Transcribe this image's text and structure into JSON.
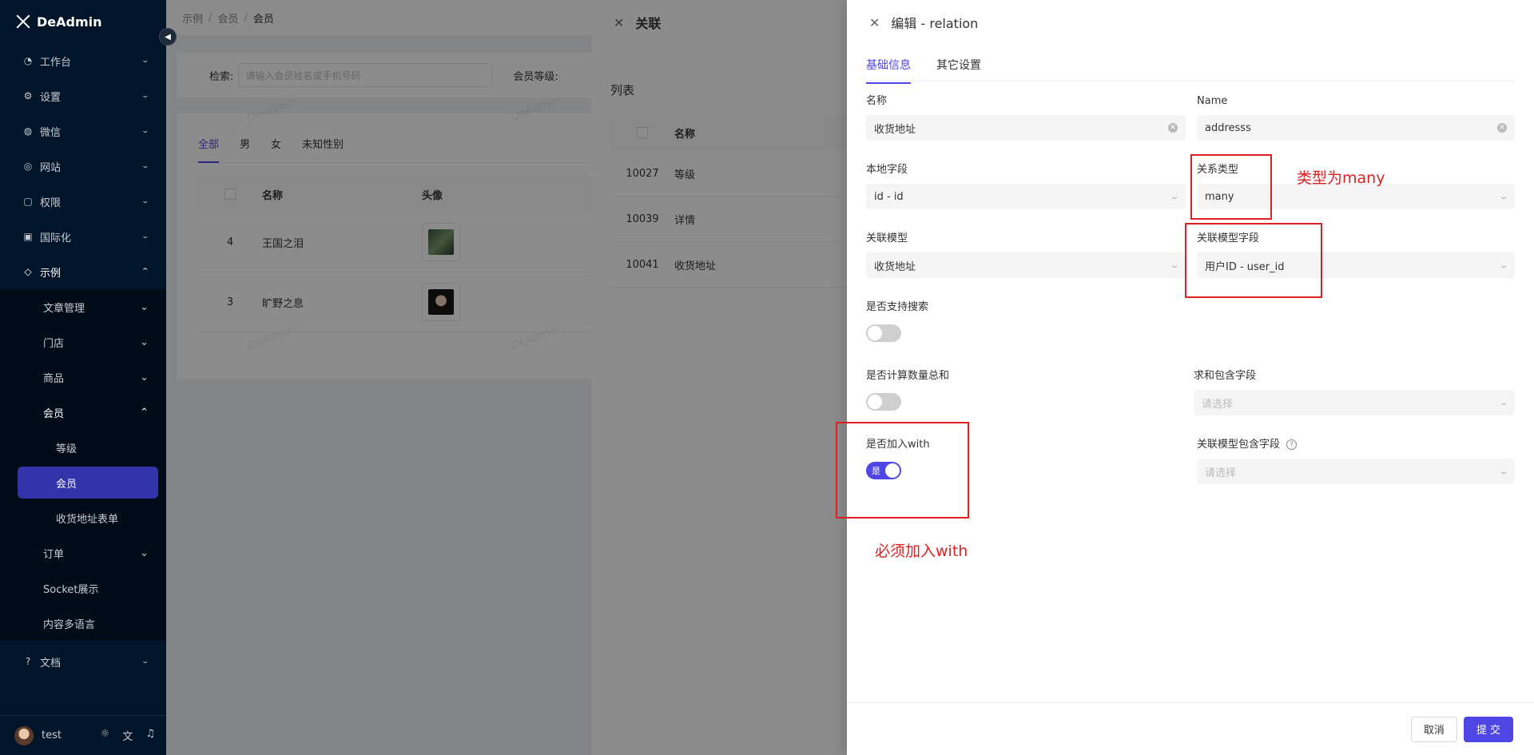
{
  "app": {
    "name": "DeAdmin"
  },
  "sidebar": {
    "items": [
      {
        "label": "工作台",
        "icon": "dashboard-icon"
      },
      {
        "label": "设置",
        "icon": "gear-icon"
      },
      {
        "label": "微信",
        "icon": "wechat-icon"
      },
      {
        "label": "网站",
        "icon": "globe-icon"
      },
      {
        "label": "权限",
        "icon": "lock-icon"
      },
      {
        "label": "国际化",
        "icon": "translate-icon"
      },
      {
        "label": "示例",
        "icon": "tag-icon"
      }
    ],
    "example_children": [
      {
        "label": "文章管理"
      },
      {
        "label": "门店"
      },
      {
        "label": "商品"
      },
      {
        "label": "会员"
      }
    ],
    "member_children": [
      "等级",
      "会员",
      "收货地址表单"
    ],
    "more_children": [
      "订单",
      "Socket展示",
      "内容多语言"
    ],
    "docs": "文档",
    "user": "test"
  },
  "breadcrumb": [
    "示例",
    "会员",
    "会员"
  ],
  "search": {
    "label": "检索:",
    "placeholder": "请输入会员姓名或手机号码",
    "level_label": "会员等级:"
  },
  "member_tabs": [
    "全部",
    "男",
    "女",
    "未知性别"
  ],
  "member_table": {
    "headers": [
      "名称",
      "头像"
    ],
    "rows": [
      {
        "id": "4",
        "name": "王国之泪"
      },
      {
        "id": "3",
        "name": "旷野之息"
      }
    ]
  },
  "watermark": "DeAdmin",
  "drawer1": {
    "title": "关联",
    "section": "列表",
    "header": "名称",
    "rows": [
      {
        "id": "10027",
        "name": "等级"
      },
      {
        "id": "10039",
        "name": "详情"
      },
      {
        "id": "10041",
        "name": "收货地址"
      }
    ]
  },
  "drawer2": {
    "title": "编辑 - relation",
    "tabs": [
      "基础信息",
      "其它设置"
    ],
    "fields": {
      "name": {
        "label": "名称",
        "value": "收货地址"
      },
      "name_en": {
        "label": "Name",
        "value": "addresss"
      },
      "local_field": {
        "label": "本地字段",
        "value": "id - id"
      },
      "relation_type": {
        "label": "关系类型",
        "value": "many"
      },
      "relation_model": {
        "label": "关联模型",
        "value": "收货地址"
      },
      "relation_model_field": {
        "label": "关联模型字段",
        "value": "用户ID - user_id"
      },
      "searchable": {
        "label": "是否支持搜索",
        "on": false
      },
      "count_sum": {
        "label": "是否计算数量总和",
        "on": false
      },
      "sum_fields": {
        "label": "求和包含字段",
        "placeholder": "请选择"
      },
      "with": {
        "label": "是否加入with",
        "on": true,
        "on_text": "是"
      },
      "model_fields": {
        "label": "关联模型包含字段",
        "placeholder": "请选择"
      }
    },
    "buttons": {
      "cancel": "取消",
      "submit": "提 交"
    }
  },
  "annotations": {
    "relation_type_note": "类型为many",
    "with_note": "必须加入with"
  },
  "colors": {
    "primary": "#4f46e5",
    "sidebar_bg": "#001529",
    "annotation": "#e02020"
  }
}
